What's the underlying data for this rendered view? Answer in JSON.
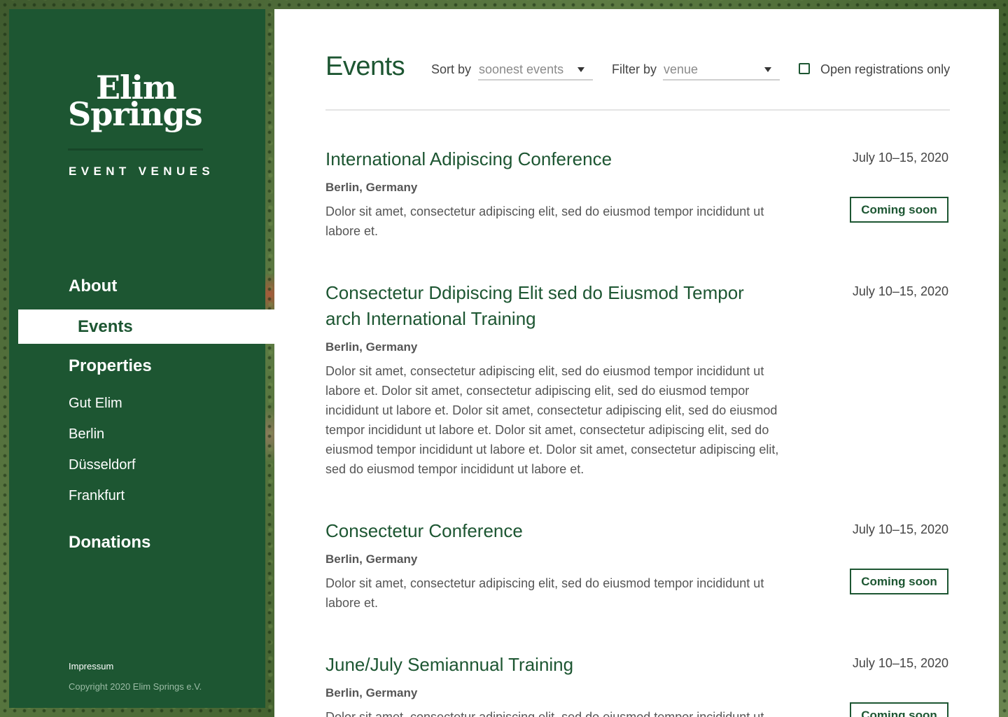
{
  "sidebar": {
    "logo": {
      "line1": "Elim",
      "line2": "Springs",
      "subtitle": "EVENT VENUES"
    },
    "nav": {
      "about": "About",
      "events": "Events",
      "properties": "Properties",
      "sub": [
        "Gut Elim",
        "Berlin",
        "Düsseldorf",
        "Frankfurt"
      ],
      "donations": "Donations"
    },
    "footer": {
      "impressum": "Impressum",
      "copyright": "Copyright 2020 Elim Springs e.V."
    }
  },
  "main": {
    "title": "Events",
    "sort": {
      "label": "Sort by",
      "value": "soonest events"
    },
    "filter": {
      "label": "Filter by",
      "value": "venue"
    },
    "open_only": {
      "label": "Open registrations only",
      "checked": false
    },
    "events": [
      {
        "title": "International Adipiscing Conference",
        "date": "July 10–15, 2020",
        "location": "Berlin, Germany",
        "description": "Dolor sit amet, consectetur adipiscing elit, sed do eiusmod tempor incididunt ut labore et.",
        "badge": "Coming soon"
      },
      {
        "title": "Consectetur Ddipiscing Elit sed do Eiusmod Tempor arch International Training",
        "date": "July 10–15, 2020",
        "location": "Berlin, Germany",
        "description": "Dolor sit amet, consectetur adipiscing elit, sed do eiusmod tempor incididunt ut labore et. Dolor sit amet, consectetur adipiscing elit, sed do eiusmod tempor incididunt ut labore et. Dolor sit amet, consectetur adipiscing elit, sed do eiusmod tempor incididunt ut labore et. Dolor sit amet, consectetur adipiscing elit, sed do eiusmod tempor incididunt ut labore et. Dolor sit amet, consectetur adipiscing elit, sed do eiusmod tempor incididunt ut labore et."
      },
      {
        "title": "Consectetur Conference",
        "date": "July 10–15, 2020",
        "location": "Berlin, Germany",
        "description": "Dolor sit amet, consectetur adipiscing elit, sed do eiusmod tempor incididunt ut labore et.",
        "badge": "Coming soon"
      },
      {
        "title": "June/July Semiannual Training",
        "date": "July 10–15, 2020",
        "location": "Berlin, Germany",
        "description": "Dolor sit amet, consectetur adipiscing elit, sed do eiusmod tempor incididunt ut labore et.",
        "badge": "Coming soon"
      }
    ]
  },
  "colors": {
    "brand_green": "#1d5632",
    "text_gray": "#555555"
  }
}
